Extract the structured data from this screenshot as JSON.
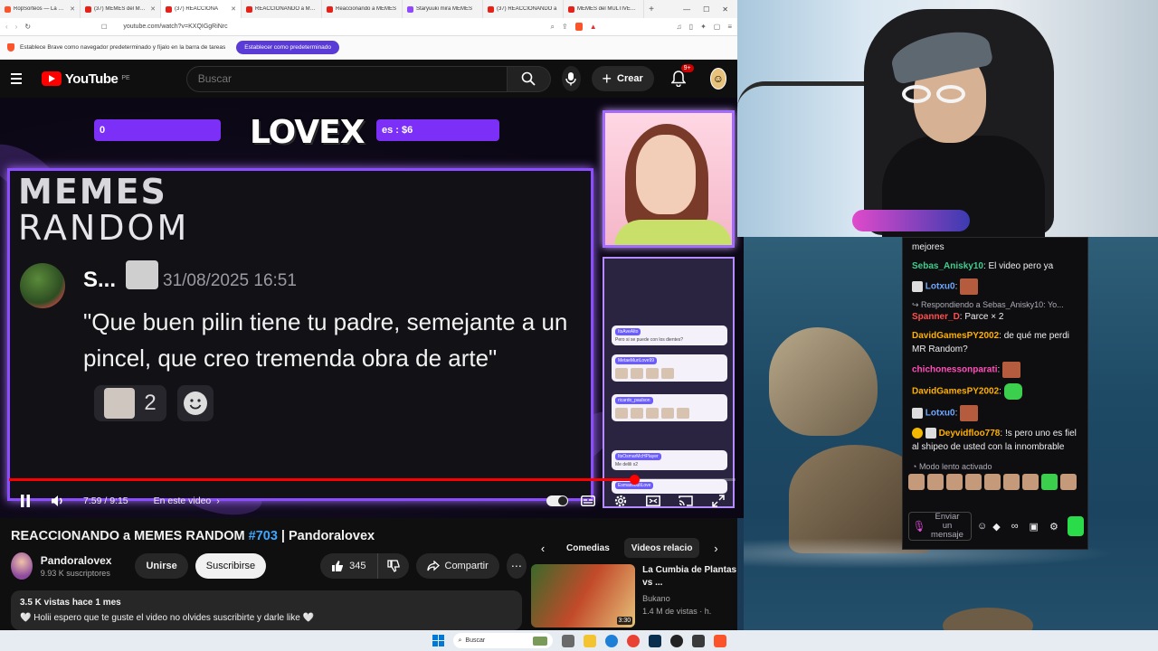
{
  "browser": {
    "tabs": [
      {
        "label": "RopSorteos — La Ruleta",
        "active": false
      },
      {
        "label": "(37) MEMES del MULTIV",
        "active": false
      },
      {
        "label": "(37) REACCIONA",
        "active": true
      },
      {
        "label": "REACCIONANDO a MEMES",
        "active": false
      },
      {
        "label": "Reaccionando a MEMES",
        "active": false
      },
      {
        "label": "Staryuuki mira MEMES",
        "active": false
      },
      {
        "label": "(37) REACCIONANDO a",
        "active": false
      },
      {
        "label": "MEMES del MULTIVERSO",
        "active": false
      }
    ],
    "url": "youtube.com/watch?v=KXQIGgRiNrc",
    "infobar_text": "Establece Brave como navegador predeterminado y fíjalo en la barra de tareas",
    "infobar_button": "Establecer como predeterminado"
  },
  "youtube": {
    "logo_text": "YouTube",
    "country": "PE",
    "search_placeholder": "Buscar",
    "create_label": "Crear",
    "notif_count": "9+",
    "video_title_pre": "REACCIONANDO a MEMES RANDOM ",
    "video_title_hash": "#703",
    "video_title_post": " | Pandoralovex",
    "channel_name": "Pandoralovex",
    "channel_subs": "9.93 K suscriptores",
    "join_label": "Unirse",
    "subscribe_label": "Suscribirse",
    "like_count": "345",
    "share_label": "Compartir",
    "desc_stats": "3.5 K vistas  hace 1 mes",
    "desc_text": "🤍 Holii espero que te guste el video no olvides suscribirte y darle like 🤍",
    "chips": [
      "Comedias",
      "Videos relacio"
    ],
    "related": {
      "title": "La Cumbia de Plantas vs ...",
      "channel": "Bukano",
      "views": "1.4 M de vistas · h.",
      "duration": "3:30"
    }
  },
  "player": {
    "time": "7:59 / 9:15",
    "chapter": "En este video",
    "progress": 0.86,
    "stat_left": "0",
    "stat_right": "es : $6",
    "brand": "LOVEX",
    "meme_title_1": "MEMES",
    "meme_title_2": "RANDOM",
    "comment_name": "S...",
    "comment_date": "31/08/2025 16:51",
    "comment_line_1": "\"Que buen pilin tiene tu padre, semejante a un",
    "comment_line_2": "pincel, que creo tremenda obra de arte\"",
    "comment_reactions": "2"
  },
  "overlay_chat": {
    "m1_user": "ItsAveAlto",
    "m1_text": "Pero si se puede con los dientes?",
    "m2_user": "MetaeMuriLove99",
    "m3_user": "ricardo_paulson",
    "m4_user": "ItsOsmarMcHPlayer",
    "m4_text": "Me delili x2",
    "m5_user": "EsmassouliLove"
  },
  "twitch_chat": {
    "messages": [
      {
        "user": "",
        "text": "mejores",
        "color": "#efeff1"
      },
      {
        "user": "Sebas_Anisky10",
        "text": "El video pero ya",
        "color": "#3ecf8e"
      },
      {
        "user": "Lotxu0",
        "text": "",
        "color": "#6fa8ff"
      },
      {
        "user": "Spanner_D",
        "text": "Parce × 2",
        "color": "#ff4f4f"
      },
      {
        "user": "DavidGamesPY2002",
        "text": "de qué me perdi MR Random?",
        "color": "#ffb000"
      },
      {
        "user": "chichonessonparati",
        "text": "",
        "color": "#ff4fb8"
      },
      {
        "user": "DavidGamesPY2002",
        "text": "",
        "color": "#ffb000"
      },
      {
        "user": "Lotxu0",
        "text": "",
        "color": "#6fa8ff"
      },
      {
        "user": "Deyvidfloo778",
        "text": "!s pero uno es fiel al shipeo de usted con la innombrable",
        "color": "#ffb000"
      }
    ],
    "reply_to": "Respondiendo a Sebas_Anisky10: Yo...",
    "slow_mode": "Modo lento activado",
    "input_placeholder": "Enviar un mensaje"
  },
  "taskbar": {
    "search_placeholder": "Buscar"
  },
  "colors": {
    "yt_red": "#ff0000",
    "overlay_purple": "#8b4dff",
    "twitch_green": "#2bdc4a"
  }
}
